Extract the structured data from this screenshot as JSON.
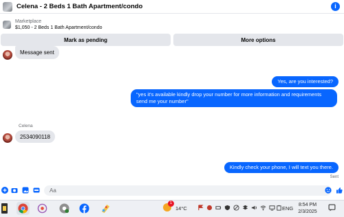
{
  "header": {
    "title": "Celena - 2 Beds 1 Bath Apartment/condo",
    "info_icon": "info-icon"
  },
  "marketplace": {
    "label": "Marketplace",
    "listing": "$1,050 - 2 Beds 1 Bath Apartment/condo"
  },
  "actions": {
    "mark_pending": "Mark as pending",
    "more_options": "More options"
  },
  "messages": [
    {
      "direction": "in",
      "text": "Message sent"
    },
    {
      "direction": "out",
      "text": "Yes, are you interested?"
    },
    {
      "direction": "out",
      "text": "\"yes it's available kindly drop your number for more information and requirements send me your number\""
    },
    {
      "direction": "in",
      "sender": "Celena",
      "text": "2534090118"
    },
    {
      "direction": "out",
      "text": "Kindly check your phone, I will text you there.",
      "status": "Sent"
    }
  ],
  "composer": {
    "placeholder": "Aa"
  },
  "taskbar": {
    "badge_count": "1",
    "weather": "14°C",
    "language": "ENG",
    "time": "8:54 PM",
    "date": "2/3/2025"
  },
  "colors": {
    "accent": "#0866ff",
    "bubble_in": "#e4e6eb",
    "taskbar": "#eef0f4"
  }
}
